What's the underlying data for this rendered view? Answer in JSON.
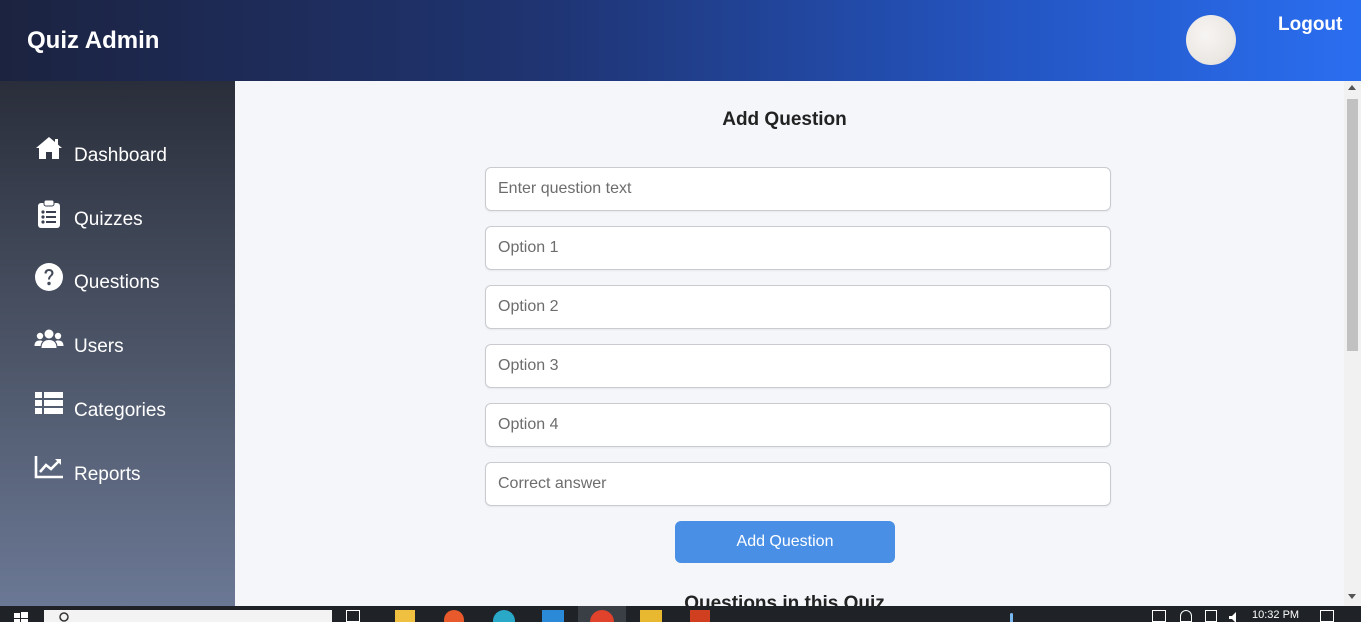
{
  "header": {
    "brand": "Quiz Admin",
    "logout_label": "Logout"
  },
  "sidebar": {
    "items": [
      {
        "label": "Dashboard",
        "icon": "home-icon"
      },
      {
        "label": "Quizzes",
        "icon": "clipboard-icon"
      },
      {
        "label": "Questions",
        "icon": "question-circle-icon"
      },
      {
        "label": "Users",
        "icon": "users-icon"
      },
      {
        "label": "Categories",
        "icon": "list-icon"
      },
      {
        "label": "Reports",
        "icon": "chart-line-icon"
      }
    ]
  },
  "form": {
    "title": "Add Question",
    "question_placeholder": "Enter question text",
    "option1_placeholder": "Option 1",
    "option2_placeholder": "Option 2",
    "option3_placeholder": "Option 3",
    "option4_placeholder": "Option 4",
    "correct_placeholder": "Correct answer",
    "submit_label": "Add Question"
  },
  "questions_section": {
    "title": "Questions in this Quiz"
  },
  "taskbar": {
    "time": "10:32 PM"
  },
  "colors": {
    "accent": "#4a8fe6",
    "header_start": "#1c2340",
    "header_end": "#2a6ef0",
    "sidebar_top": "#2a2e3b",
    "sidebar_bottom": "#6b7895",
    "background": "#f4f6fa"
  }
}
